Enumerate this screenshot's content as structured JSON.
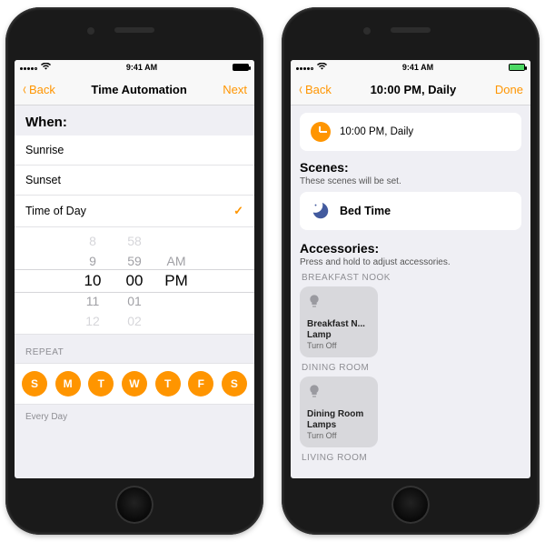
{
  "status": {
    "time": "9:41 AM"
  },
  "accent": "#ff9500",
  "left": {
    "nav": {
      "back": "Back",
      "title": "Time Automation",
      "next": "Next"
    },
    "when_label": "When:",
    "options": [
      "Sunrise",
      "Sunset",
      "Time of Day"
    ],
    "selected_index": 2,
    "picker": {
      "hours": [
        "8",
        "9",
        "10",
        "11",
        "12"
      ],
      "minutes": [
        "58",
        "59",
        "00",
        "01",
        "02"
      ],
      "ampm": [
        "AM",
        "PM"
      ]
    },
    "repeat_label": "REPEAT",
    "days": [
      "S",
      "M",
      "T",
      "W",
      "T",
      "F",
      "S"
    ],
    "repeat_summary": "Every Day"
  },
  "right": {
    "nav": {
      "back": "Back",
      "title": "10:00 PM, Daily",
      "done": "Done"
    },
    "summary": "10:00 PM, Daily",
    "scenes": {
      "heading": "Scenes:",
      "sub": "These scenes will be set.",
      "items": [
        {
          "name": "Bed Time"
        }
      ]
    },
    "accessories": {
      "heading": "Accessories:",
      "sub": "Press and hold to adjust accessories.",
      "rooms": [
        {
          "name": "BREAKFAST NOOK",
          "tiles": [
            {
              "name": "Breakfast N... Lamp",
              "state": "Turn Off"
            }
          ]
        },
        {
          "name": "DINING ROOM",
          "tiles": [
            {
              "name": "Dining Room Lamps",
              "state": "Turn Off"
            }
          ]
        },
        {
          "name": "LIVING ROOM",
          "tiles": []
        }
      ]
    }
  }
}
